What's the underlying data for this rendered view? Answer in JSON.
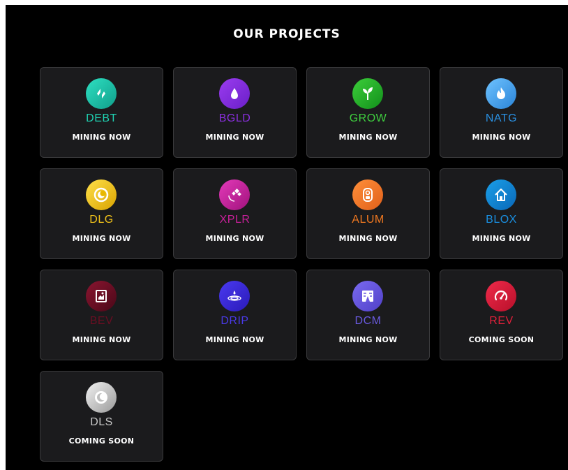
{
  "title": "OUR PROJECTS",
  "projects": [
    {
      "symbol": "DEBT",
      "status": "MINING NOW",
      "color": "#1fd3b3",
      "grad": "linear-gradient(135deg,#2ee0c2,#109e8a)",
      "icon": "lightning-icon"
    },
    {
      "symbol": "BGLD",
      "status": "MINING NOW",
      "color": "#8b2fe0",
      "grad": "linear-gradient(135deg,#9b3cf0,#6a1fc8)",
      "icon": "droplet-icon"
    },
    {
      "symbol": "GROW",
      "status": "MINING NOW",
      "color": "#3fcf3f",
      "grad": "linear-gradient(135deg,#3ccf3a,#128f1b)",
      "icon": "sprout-icon"
    },
    {
      "symbol": "NATG",
      "status": "MINING NOW",
      "color": "#2a8fe0",
      "grad": "linear-gradient(135deg,#6fc3ff,#2a84d8)",
      "icon": "flame-icon"
    },
    {
      "symbol": "DLG",
      "status": "MINING NOW",
      "color": "#f0c21a",
      "grad": "linear-gradient(135deg,#ffe04a,#d9a300)",
      "icon": "moon-ring-icon"
    },
    {
      "symbol": "XPLR",
      "status": "MINING NOW",
      "color": "#c8209a",
      "grad": "linear-gradient(135deg,#e43aba,#a0127c)",
      "icon": "satellite-icon"
    },
    {
      "symbol": "ALUM",
      "status": "MINING NOW",
      "color": "#f07820",
      "grad": "linear-gradient(135deg,#ff8f3a,#e0601a)",
      "icon": "can-icon"
    },
    {
      "symbol": "BLOX",
      "status": "MINING NOW",
      "color": "#1a8fe0",
      "grad": "linear-gradient(135deg,#1a9fe8,#0a68b8)",
      "icon": "house-icon"
    },
    {
      "symbol": "BEV",
      "status": "MINING NOW",
      "color": "#6a0e22",
      "grad": "linear-gradient(135deg,#8a1530,#4a0818)",
      "icon": "glass-icon"
    },
    {
      "symbol": "DRIP",
      "status": "MINING NOW",
      "color": "#4a3ae8",
      "grad": "linear-gradient(135deg,#4a3af0,#2a1ab8)",
      "icon": "ripple-icon"
    },
    {
      "symbol": "DCM",
      "status": "MINING NOW",
      "color": "#6a5ae0",
      "grad": "linear-gradient(135deg,#7a6af0,#5040c8)",
      "icon": "map-icon"
    },
    {
      "symbol": "REV",
      "status": "COMING SOON",
      "color": "#e0203a",
      "grad": "linear-gradient(135deg,#ef2a4a,#b8102a)",
      "icon": "speedometer-icon"
    },
    {
      "symbol": "DLS",
      "status": "COMING SOON",
      "color": "#c8c8c8",
      "grad": "linear-gradient(135deg,#f2f2f2,#9a9a9a)",
      "icon": "crescent-icon"
    }
  ]
}
